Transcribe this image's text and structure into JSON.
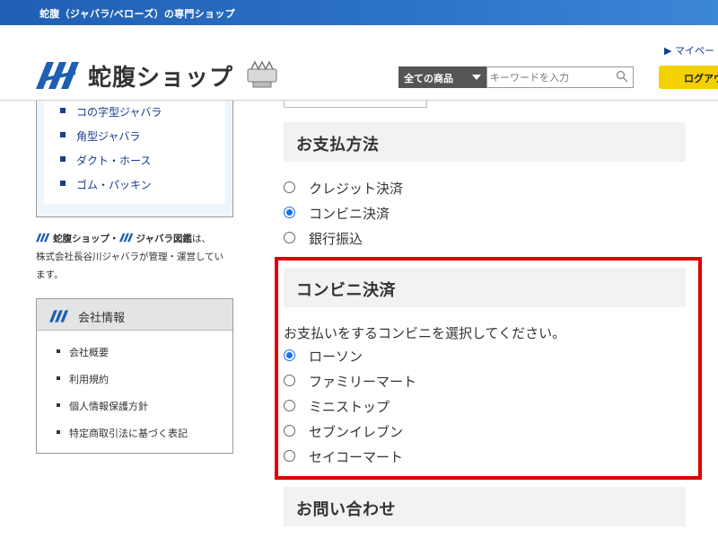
{
  "top_banner": {
    "text": "蛇腹（ジャバラ/ベローズ）の専門ショップ"
  },
  "header": {
    "logo_text": "蛇腹ショップ",
    "mypage": "▶ マイペー",
    "search": {
      "category": "全ての商品",
      "placeholder": "キーワードを入力",
      "value": ""
    },
    "login": "ログアウ"
  },
  "sidebar": {
    "categories": [
      "コの字型ジャバラ",
      "角型ジャバラ",
      "ダクト・ホース",
      "ゴム・パッキン"
    ],
    "about": {
      "brand": "蛇腹ショップ・",
      "brand2": "ジャバラ図鑑",
      "text1": "は、",
      "text2": "株式会社長谷川ジャバラが管理・運営してい",
      "text3": "ます。"
    },
    "company": {
      "title": "会社情報",
      "items": [
        "会社概要",
        "利用規約",
        "個人情報保護方針",
        "特定商取引法に基づく表記"
      ]
    }
  },
  "payment": {
    "title": "お支払方法",
    "options": [
      {
        "label": "クレジット決済",
        "checked": false
      },
      {
        "label": "コンビニ決済",
        "checked": true
      },
      {
        "label": "銀行振込",
        "checked": false
      }
    ]
  },
  "convenience": {
    "title": "コンビニ決済",
    "instruction": "お支払いをするコンビニを選択してください。",
    "options": [
      {
        "label": "ローソン",
        "checked": true
      },
      {
        "label": "ファミリーマート",
        "checked": false
      },
      {
        "label": "ミニストップ",
        "checked": false
      },
      {
        "label": "セブンイレブン",
        "checked": false
      },
      {
        "label": "セイコーマート",
        "checked": false
      }
    ]
  },
  "contact": {
    "title": "お問い合わせ"
  },
  "colors": {
    "brand_blue": "#1f5fb3",
    "accent_red": "#e00000",
    "login_yellow": "#f3d000",
    "radio_blue": "#1a73e8"
  }
}
